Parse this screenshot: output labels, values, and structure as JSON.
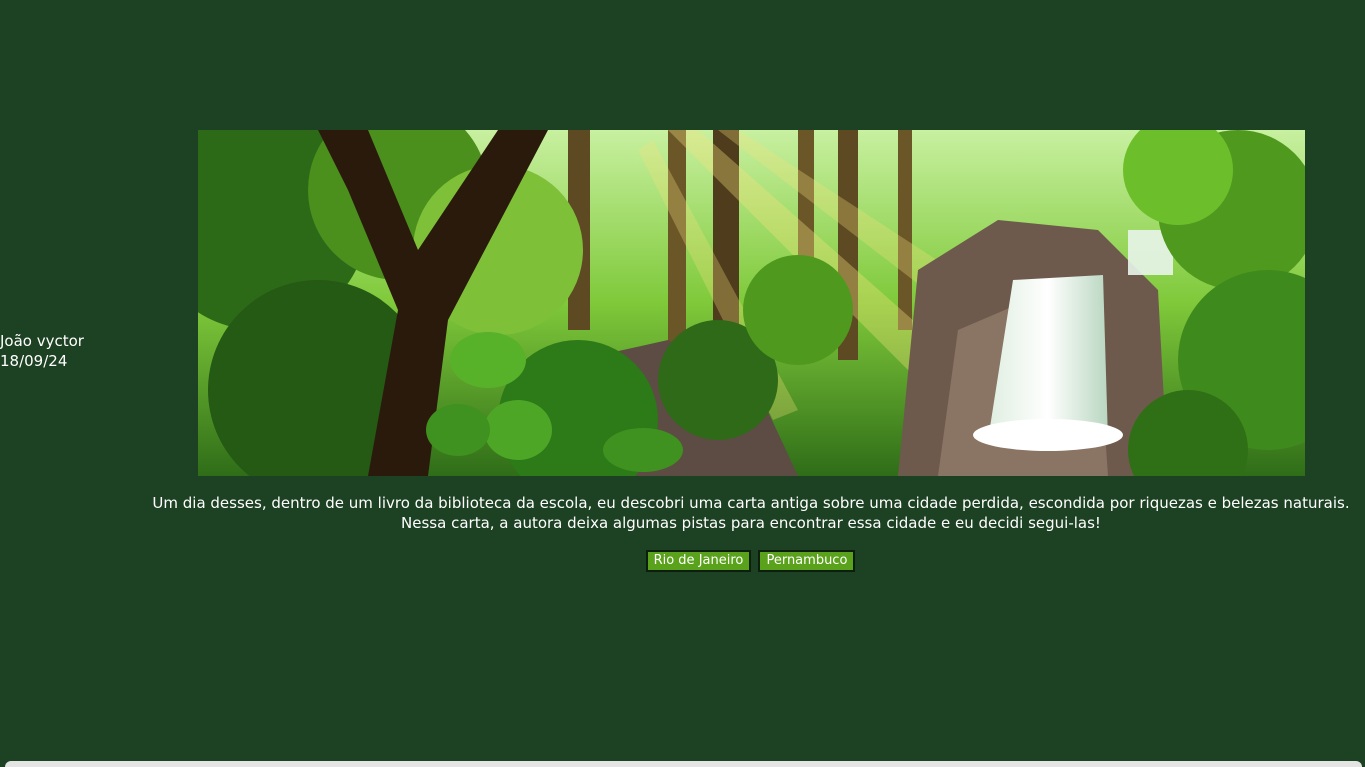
{
  "author": {
    "name": "João vyctor",
    "date": "18/09/24"
  },
  "banner": {
    "icon": "forest-waterfall-illustration"
  },
  "story": {
    "text": "Um dia desses, dentro de um livro da biblioteca da escola, eu descobri uma carta antiga sobre uma cidade perdida, escondida por riquezas e belezas naturais. Nessa carta, a autora deixa algumas pistas para encontrar essa cidade e eu decidi segui-las!"
  },
  "choices": {
    "option1": "Rio de Janeiro",
    "option2": "Pernambuco"
  },
  "colors": {
    "background": "#1d4123",
    "button": "#5aa21c",
    "text": "#ffffff"
  }
}
